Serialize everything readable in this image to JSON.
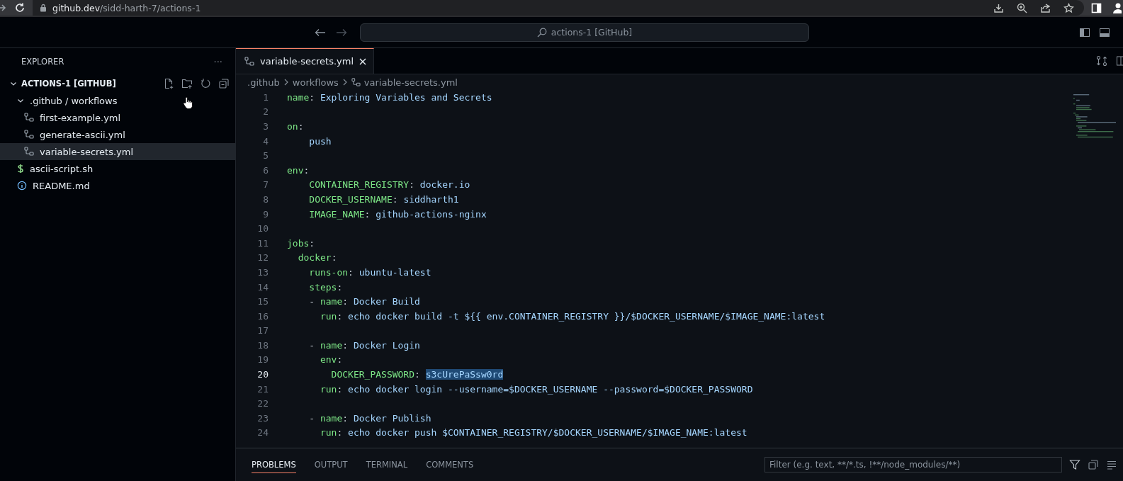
{
  "browser": {
    "url_host": "github.dev",
    "url_path": "/sidd-harth-7/actions-1"
  },
  "command_center": {
    "label": "actions-1 [GitHub]"
  },
  "explorer": {
    "title": "EXPLORER",
    "more": "···",
    "root": {
      "label": "ACTIONS-1 [GITHUB]",
      "expanded": true,
      "children": [
        {
          "label": ".github / workflows",
          "kind": "folder",
          "expanded": true,
          "selected": false,
          "children": [
            {
              "label": "first-example.yml",
              "kind": "workflow",
              "selected": false
            },
            {
              "label": "generate-ascii.yml",
              "kind": "workflow",
              "selected": false
            },
            {
              "label": "variable-secrets.yml",
              "kind": "workflow",
              "selected": true
            }
          ]
        },
        {
          "label": "ascii-script.sh",
          "kind": "shell",
          "selected": false
        },
        {
          "label": "README.md",
          "kind": "info",
          "selected": false
        }
      ]
    }
  },
  "editor": {
    "tabs": [
      {
        "label": "variable-secrets.yml",
        "selected": true
      }
    ],
    "breadcrumb": [
      ".github",
      "workflows",
      "variable-secrets.yml"
    ],
    "lines": [
      {
        "number": "1",
        "current": false,
        "tokens": [
          {
            "text": "name",
            "kind": "key"
          },
          {
            "text": ": ",
            "kind": "plain"
          },
          {
            "text": "Exploring Variables and Secrets",
            "kind": "value"
          }
        ]
      },
      {
        "number": "2",
        "current": false
      },
      {
        "number": "3",
        "current": false,
        "tokens": [
          {
            "text": "on",
            "kind": "key"
          },
          {
            "text": ":",
            "kind": "plain"
          }
        ]
      },
      {
        "number": "4",
        "current": false,
        "tokens": [
          {
            "text": "    push",
            "kind": "value"
          }
        ]
      },
      {
        "number": "5",
        "current": false
      },
      {
        "number": "6",
        "current": false,
        "tokens": [
          {
            "text": "env",
            "kind": "key"
          },
          {
            "text": ":",
            "kind": "plain"
          }
        ]
      },
      {
        "number": "7",
        "current": false,
        "tokens": [
          {
            "text": "    CONTAINER_REGISTRY",
            "kind": "key"
          },
          {
            "text": ": ",
            "kind": "plain"
          },
          {
            "text": "docker.io",
            "kind": "value"
          }
        ]
      },
      {
        "number": "8",
        "current": false,
        "tokens": [
          {
            "text": "    DOCKER_USERNAME",
            "kind": "key"
          },
          {
            "text": ": ",
            "kind": "plain"
          },
          {
            "text": "siddharth1",
            "kind": "value"
          }
        ]
      },
      {
        "number": "9",
        "current": false,
        "tokens": [
          {
            "text": "    IMAGE_NAME",
            "kind": "key"
          },
          {
            "text": ": ",
            "kind": "plain"
          },
          {
            "text": "github-actions-nginx",
            "kind": "value"
          }
        ]
      },
      {
        "number": "10",
        "current": false
      },
      {
        "number": "11",
        "current": false,
        "tokens": [
          {
            "text": "jobs",
            "kind": "key"
          },
          {
            "text": ":",
            "kind": "plain"
          }
        ]
      },
      {
        "number": "12",
        "current": false,
        "tokens": [
          {
            "text": "  docker",
            "kind": "key"
          },
          {
            "text": ":",
            "kind": "plain"
          }
        ]
      },
      {
        "number": "13",
        "current": false,
        "tokens": [
          {
            "text": "    runs-on",
            "kind": "key"
          },
          {
            "text": ": ",
            "kind": "plain"
          },
          {
            "text": "ubuntu-latest",
            "kind": "value"
          }
        ]
      },
      {
        "number": "14",
        "current": false,
        "tokens": [
          {
            "text": "    steps",
            "kind": "key"
          },
          {
            "text": ":",
            "kind": "plain"
          }
        ]
      },
      {
        "number": "15",
        "current": false,
        "tokens": [
          {
            "text": "    - ",
            "kind": "plain"
          },
          {
            "text": "name",
            "kind": "key"
          },
          {
            "text": ": ",
            "kind": "plain"
          },
          {
            "text": "Docker Build",
            "kind": "value"
          }
        ]
      },
      {
        "number": "16",
        "current": false,
        "tokens": [
          {
            "text": "      run",
            "kind": "key"
          },
          {
            "text": ": ",
            "kind": "plain"
          },
          {
            "text": "echo docker build -t ${{ env.CONTAINER_REGISTRY }}/$DOCKER_USERNAME/$IMAGE_NAME:latest",
            "kind": "value"
          }
        ]
      },
      {
        "number": "17",
        "current": false
      },
      {
        "number": "18",
        "current": false,
        "tokens": [
          {
            "text": "    - ",
            "kind": "plain"
          },
          {
            "text": "name",
            "kind": "key"
          },
          {
            "text": ": ",
            "kind": "plain"
          },
          {
            "text": "Docker Login",
            "kind": "value"
          }
        ]
      },
      {
        "number": "19",
        "current": false,
        "tokens": [
          {
            "text": "      env",
            "kind": "key"
          },
          {
            "text": ":",
            "kind": "plain"
          }
        ]
      },
      {
        "number": "20",
        "current": true,
        "tokens": [
          {
            "text": "        DOCKER_PASSWORD",
            "kind": "key"
          },
          {
            "text": ": ",
            "kind": "plain"
          },
          {
            "text": "s3cUrePaSsw0rd",
            "kind": "selected"
          }
        ]
      },
      {
        "number": "21",
        "current": false,
        "tokens": [
          {
            "text": "      run",
            "kind": "key"
          },
          {
            "text": ": ",
            "kind": "plain"
          },
          {
            "text": "echo docker login --username=$DOCKER_USERNAME --password=$DOCKER_PASSWORD",
            "kind": "value"
          }
        ]
      },
      {
        "number": "22",
        "current": false
      },
      {
        "number": "23",
        "current": false,
        "tokens": [
          {
            "text": "    - ",
            "kind": "plain"
          },
          {
            "text": "name",
            "kind": "key"
          },
          {
            "text": ": ",
            "kind": "plain"
          },
          {
            "text": "Docker Publish",
            "kind": "value"
          }
        ]
      },
      {
        "number": "24",
        "current": false,
        "tokens": [
          {
            "text": "      run",
            "kind": "key"
          },
          {
            "text": ": ",
            "kind": "plain"
          },
          {
            "text": "echo docker push $CONTAINER_REGISTRY/$DOCKER_USERNAME/$IMAGE_NAME:latest",
            "kind": "value"
          }
        ]
      }
    ]
  },
  "panel": {
    "tabs": [
      {
        "label": "PROBLEMS",
        "selected": true
      },
      {
        "label": "OUTPUT",
        "selected": false
      },
      {
        "label": "TERMINAL",
        "selected": false
      },
      {
        "label": "COMMENTS",
        "selected": false
      }
    ],
    "filter": {
      "placeholder": "Filter (e.g. text, **/*.ts, !**/node_modules/**)"
    }
  }
}
